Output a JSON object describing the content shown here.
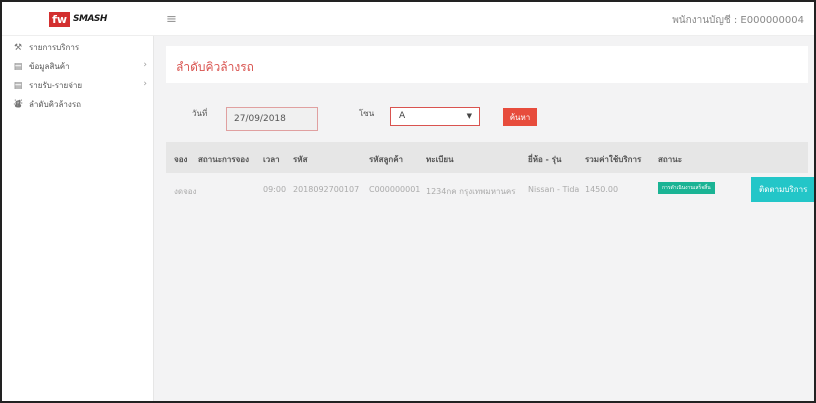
{
  "header": {
    "brand_badge": "fw",
    "brand_word": "SMASH",
    "menu_icon": "hamburger-icon",
    "user_label": "พนักงานบัญชี : E000000004"
  },
  "sidebar": {
    "items": [
      {
        "icon": "tool-icon",
        "label": "รายการบริการ",
        "has_arrow": false
      },
      {
        "icon": "bar-chart-icon",
        "label": "ข้อมูลสินค้า",
        "has_arrow": true
      },
      {
        "icon": "bar-chart-icon",
        "label": "รายรับ-รายจ่าย",
        "has_arrow": true
      },
      {
        "icon": "car-icon",
        "label": "ลำดับคิวล้างรถ",
        "has_arrow": false
      }
    ]
  },
  "main": {
    "title": "ลำดับคิวล้างรถ",
    "filter": {
      "date_label": "วันที่",
      "date_value": "27/09/2018",
      "zone_label": "โซน",
      "zone_value": "A",
      "search_label": "ค้นหา"
    },
    "table": {
      "headers": [
        "จอง",
        "สถานะการจอง",
        "เวลา",
        "รหัส",
        "รหัสลูกค้า",
        "ทะเบียน",
        "ยี่ห้อ - รุ่น",
        "รวมค่าใช้บริการ",
        "สถานะ"
      ],
      "rows": [
        {
          "booking": "งดจอง",
          "booking_status": "",
          "time": "09:00",
          "code": "2018092700107",
          "customer_code": "C000000001",
          "plate": "1234กค กรุงเทพมหานคร",
          "brand_model": "Nissan - Tida",
          "total": "1450.00",
          "status": "การดำเนินงานเสร็จสิ้น",
          "action": "ติดตามบริการ"
        }
      ]
    }
  },
  "colors": {
    "accent_red": "#e74c3c",
    "title_red": "#d9534f",
    "badge_green": "#1ab394",
    "action_teal": "#23c6c8"
  }
}
